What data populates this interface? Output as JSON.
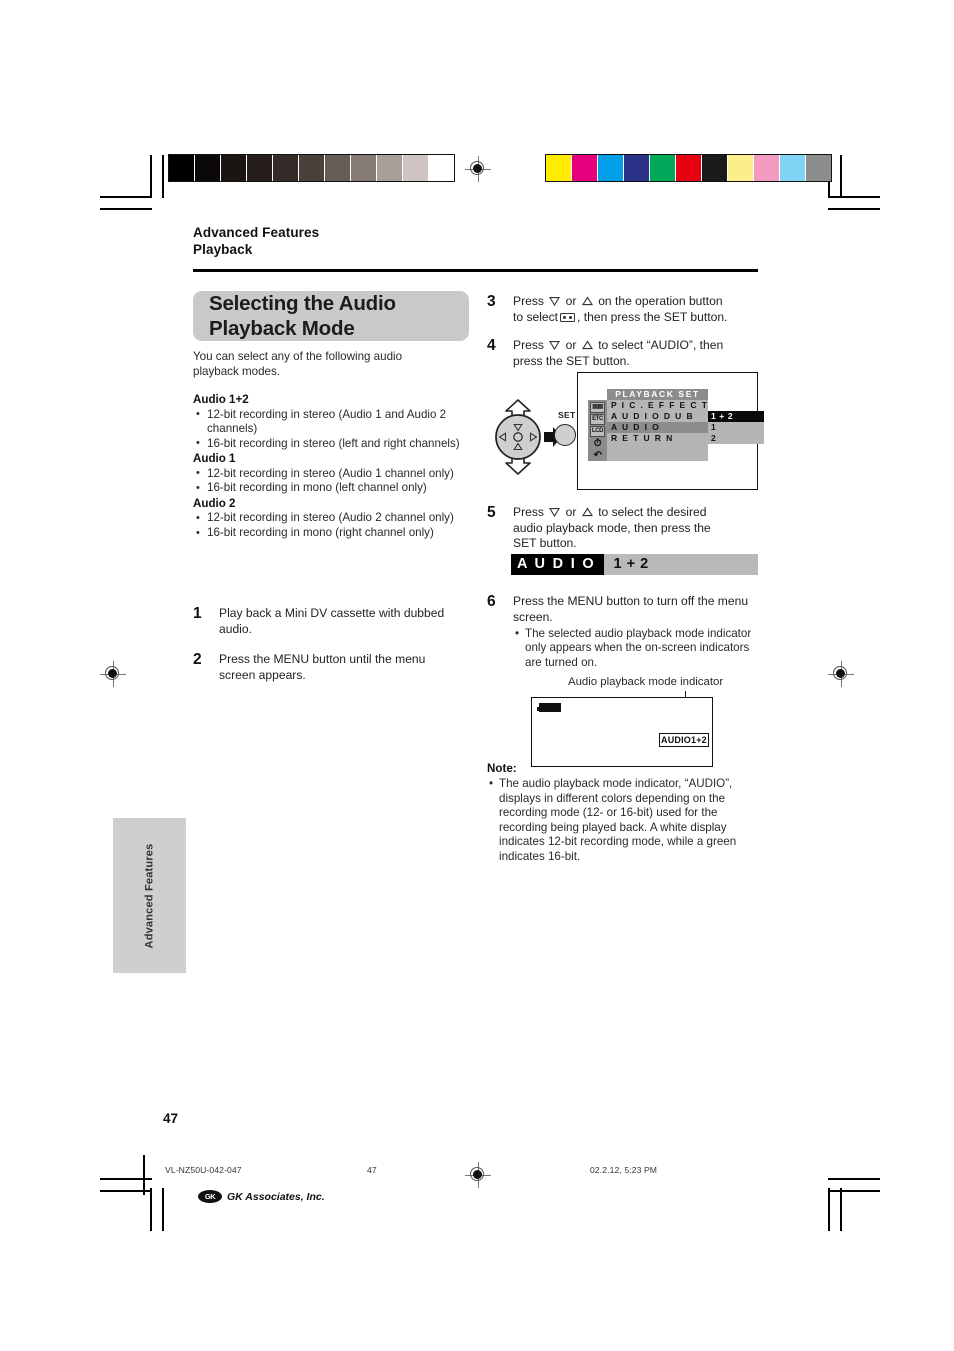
{
  "print_marks": {
    "grayscale_swatches": [
      "#000000",
      "#0b0808",
      "#1a1513",
      "#251e1b",
      "#332b27",
      "#4b413c",
      "#675c58",
      "#857a76",
      "#a89e9a",
      "#cfc4c1",
      "#ffffff"
    ],
    "color_swatches": [
      "#ffec00",
      "#e6007e",
      "#00a0e9",
      "#2b3288",
      "#00a85a",
      "#e60012",
      "#1a1a1a",
      "#fbef8a",
      "#f49ac1",
      "#7fd4f5",
      "#8c8c8c"
    ],
    "registration_icon": "registration-target-icon"
  },
  "header": {
    "kicker_line1": "Advanced Features",
    "kicker_line2": "Playback"
  },
  "title": {
    "line1": "Selecting the Audio",
    "line2": "Playback Mode"
  },
  "intro": "You can select any of the following audio playback modes.",
  "modes": [
    {
      "name": "Audio 1+2",
      "bullets": [
        "12-bit recording in stereo (Audio 1 and Audio 2 channels)",
        "16-bit recording in stereo (left and right channels)"
      ]
    },
    {
      "name": "Audio 1",
      "bullets": [
        "12-bit recording in stereo (Audio 1 channel only)",
        "16-bit recording in mono (left channel only)"
      ]
    },
    {
      "name": "Audio 2",
      "bullets": [
        "12-bit recording in stereo (Audio 2 channel only)",
        "16-bit recording in mono (right channel only)"
      ]
    }
  ],
  "steps": {
    "s1": {
      "num": "1",
      "text": "Play back a Mini DV cassette with dubbed audio."
    },
    "s2": {
      "num": "2",
      "text": "Press the MENU button until the menu screen appears."
    },
    "s3": {
      "num": "3",
      "part1": "Press",
      "or": "or",
      "part2": "on the operation button",
      "part3": "to select",
      "part4": ", then press the SET button."
    },
    "s4": {
      "num": "4",
      "part1": "Press",
      "or": "or",
      "part2": "to select “AUDIO”, then",
      "part3": "press the SET button."
    },
    "s5": {
      "num": "5",
      "part1": "Press",
      "or": "or",
      "part2": "to select the desired",
      "part3": "audio playback mode, then press the",
      "part4": "SET button."
    },
    "s6": {
      "num": "6",
      "text": "Press the MENU button to turn off the menu screen.",
      "bullet": "The selected audio playback mode indicator only appears when the on-screen indicators are turned on."
    }
  },
  "operation_diagram": {
    "set_label": "SET",
    "dpad_icon": "four-way-operation-button-icon",
    "arrow_icon": "right-arrow-icon",
    "set_button_icon": "set-button-icon"
  },
  "menu_screen": {
    "title": "PLAYBACK  SET",
    "icons": [
      "cassette-icon",
      "ETC",
      "LCD",
      "clock-icon",
      "return-arrow-icon"
    ],
    "rows": [
      {
        "label": "P I C . E F F E C T",
        "selected": false
      },
      {
        "label": "A U D I O   D U B",
        "selected": false
      },
      {
        "label": "A U D I O",
        "selected": true
      },
      {
        "label": "R E T U R N",
        "selected": false
      }
    ],
    "options": [
      {
        "label": "1 + 2",
        "selected": true
      },
      {
        "label": "1",
        "selected": false
      },
      {
        "label": "2",
        "selected": false
      }
    ]
  },
  "audio_bar": {
    "label": "A U D I O",
    "value": "1 + 2"
  },
  "indicator_figure": {
    "callout": "Audio playback mode indicator",
    "battery_icon": "battery-icon",
    "chip_text": "AUDIO1+2"
  },
  "note": {
    "heading": "Note:",
    "text": "The audio playback mode indicator, “AUDIO”, displays in different colors depending on the recording mode (12- or 16-bit) used for the recording being played back. A white display indicates 12-bit recording mode, while a green indicates 16-bit."
  },
  "side_tab": {
    "label": "Advanced Features"
  },
  "page_number": "47",
  "footer": {
    "file_id": "VL-NZ50U-042-047",
    "page": "47",
    "timestamp": "02.2.12, 5:23 PM",
    "company_mark": "GK",
    "company_name": "GK Associates, Inc."
  }
}
